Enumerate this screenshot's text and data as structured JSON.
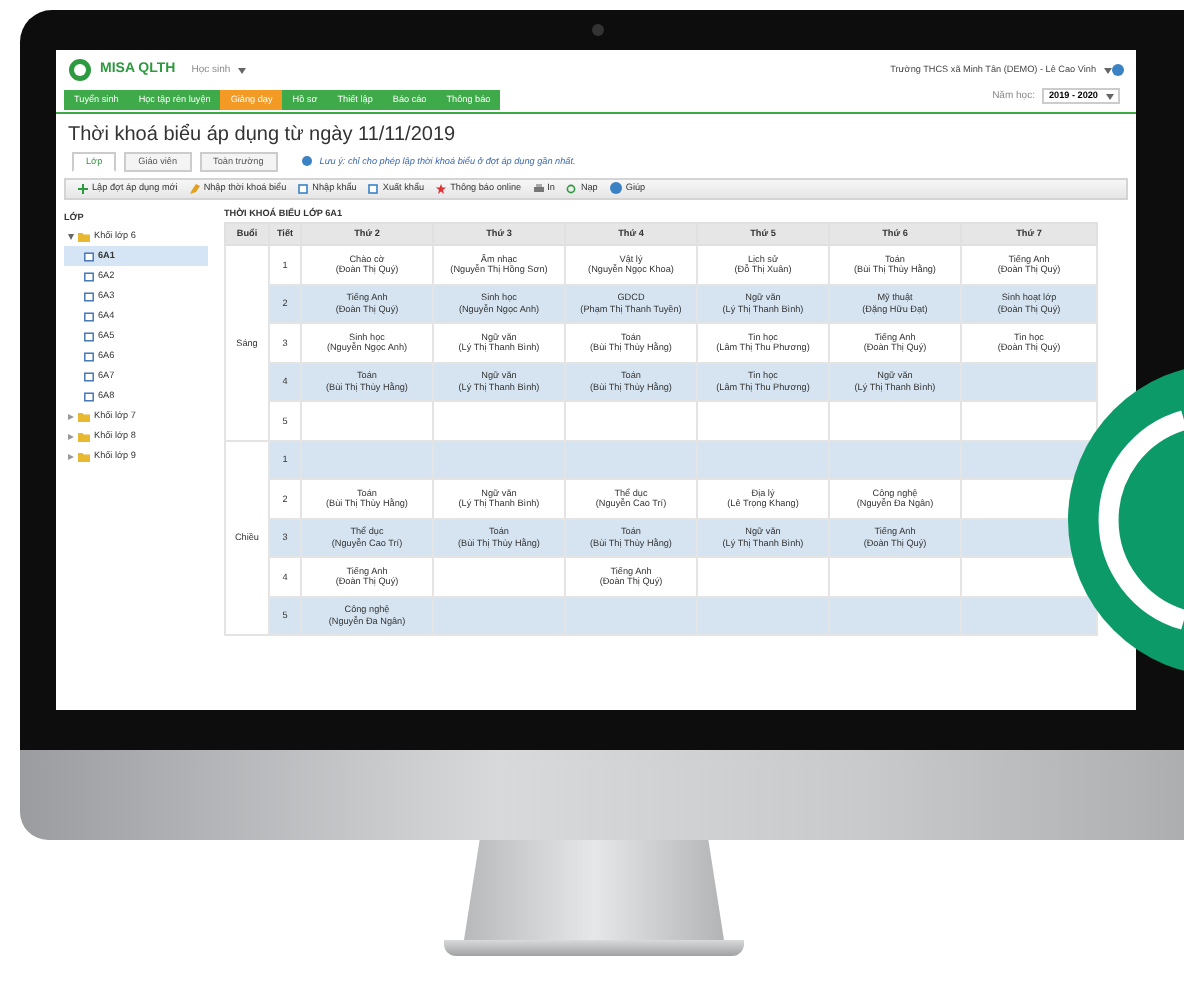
{
  "app": {
    "logo": "MISA QLTH",
    "module": "Học sinh",
    "account": "Trường THCS xã Minh Tân (DEMO) - Lê Cao Vinh",
    "school_year_label": "Năm học:",
    "school_year": "2019 - 2020"
  },
  "nav": [
    {
      "label": "Tuyển sinh",
      "selected": false
    },
    {
      "label": "Học tập rèn luyện",
      "selected": false
    },
    {
      "label": "Giảng dạy",
      "selected": true
    },
    {
      "label": "Hồ sơ",
      "selected": false
    },
    {
      "label": "Thiết lập",
      "selected": false
    },
    {
      "label": "Báo cáo",
      "selected": false
    },
    {
      "label": "Thông báo",
      "selected": false
    }
  ],
  "page_title": "Thời khoá biểu áp dụng từ ngày 11/11/2019",
  "view_tabs": [
    {
      "label": "Lớp",
      "selected": true
    },
    {
      "label": "Giáo viên",
      "selected": false
    },
    {
      "label": "Toàn trường",
      "selected": false
    }
  ],
  "note": "Lưu ý: chỉ cho phép lập thời khoá biểu ở đợt áp dụng gần nhất.",
  "toolbar": [
    "Lập đợt áp dụng mới",
    "Nhập thời khoá biểu",
    "Nhập khẩu",
    "Xuất khẩu",
    "Thông báo online",
    "In",
    "Nạp",
    "Giúp"
  ],
  "tree": {
    "heading": "LỚP",
    "items": [
      {
        "label": "Khối lớp 6",
        "expanded": true,
        "children": [
          {
            "label": "6A1",
            "selected": true
          },
          {
            "label": "6A2",
            "selected": false
          },
          {
            "label": "6A3",
            "selected": false
          },
          {
            "label": "6A4",
            "selected": false
          },
          {
            "label": "6A5",
            "selected": false
          },
          {
            "label": "6A6",
            "selected": false
          },
          {
            "label": "6A7",
            "selected": false
          },
          {
            "label": "6A8",
            "selected": false
          }
        ]
      },
      {
        "label": "Khối lớp 7",
        "expanded": false
      },
      {
        "label": "Khối lớp 8",
        "expanded": false
      },
      {
        "label": "Khối lớp 9",
        "expanded": false
      }
    ]
  },
  "timetable": {
    "title": "THỜI KHOÁ BIỂU LỚP 6A1",
    "columns": [
      "Buổi",
      "Tiết",
      "Thứ 2",
      "Thứ 3",
      "Thứ 4",
      "Thứ 5",
      "Thứ 6",
      "Thứ 7"
    ],
    "sessions": [
      {
        "name": "Sáng",
        "periods": [
          {
            "number": "1",
            "cells": [
              {
                "subject": "Chào cờ",
                "teacher": "(Đoàn Thị Quý)"
              },
              {
                "subject": "Âm nhạc",
                "teacher": "(Nguyễn Thị Hồng Sơn)"
              },
              {
                "subject": "Vật lý",
                "teacher": "(Nguyễn Ngọc Khoa)"
              },
              {
                "subject": "Lịch sử",
                "teacher": "(Đỗ Thị Xuân)"
              },
              {
                "subject": "Toán",
                "teacher": "(Bùi Thị Thùy Hằng)"
              },
              {
                "subject": "Tiếng Anh",
                "teacher": "(Đoàn Thị Quý)"
              }
            ]
          },
          {
            "number": "2",
            "cells": [
              {
                "subject": "Tiếng Anh",
                "teacher": "(Đoàn Thị Quý)"
              },
              {
                "subject": "Sinh học",
                "teacher": "(Nguyễn Ngọc Anh)"
              },
              {
                "subject": "GDCD",
                "teacher": "(Phạm Thị Thanh Tuyền)"
              },
              {
                "subject": "Ngữ văn",
                "teacher": "(Lý Thị Thanh Bình)"
              },
              {
                "subject": "Mỹ thuật",
                "teacher": "(Đặng Hữu Đạt)"
              },
              {
                "subject": "Sinh hoạt lớp",
                "teacher": "(Đoàn Thị Quý)"
              }
            ]
          },
          {
            "number": "3",
            "cells": [
              {
                "subject": "Sinh học",
                "teacher": "(Nguyễn Ngọc Anh)"
              },
              {
                "subject": "Ngữ văn",
                "teacher": "(Lý Thị Thanh Bình)"
              },
              {
                "subject": "Toán",
                "teacher": "(Bùi Thị Thùy Hằng)"
              },
              {
                "subject": "Tin học",
                "teacher": "(Lâm Thị Thu Phương)"
              },
              {
                "subject": "Tiếng Anh",
                "teacher": "(Đoàn Thị Quý)"
              },
              {
                "subject": "Tin học",
                "teacher": "(Đoàn Thị Quý)"
              }
            ]
          },
          {
            "number": "4",
            "cells": [
              {
                "subject": "Toán",
                "teacher": "(Bùi Thị Thùy Hằng)"
              },
              {
                "subject": "Ngữ văn",
                "teacher": "(Lý Thị Thanh Bình)"
              },
              {
                "subject": "Toán",
                "teacher": "(Bùi Thị Thùy Hằng)"
              },
              {
                "subject": "Tin học",
                "teacher": "(Lâm Thị Thu Phương)"
              },
              {
                "subject": "Ngữ văn",
                "teacher": "(Lý Thị Thanh Bình)"
              },
              null
            ]
          },
          {
            "number": "5",
            "cells": [
              null,
              null,
              null,
              null,
              null,
              null
            ]
          }
        ]
      },
      {
        "name": "Chiều",
        "periods": [
          {
            "number": "1",
            "cells": [
              null,
              null,
              null,
              null,
              null,
              null
            ]
          },
          {
            "number": "2",
            "cells": [
              {
                "subject": "Toán",
                "teacher": "(Bùi Thị Thùy Hằng)"
              },
              {
                "subject": "Ngữ văn",
                "teacher": "(Lý Thị Thanh Bình)"
              },
              {
                "subject": "Thể dục",
                "teacher": "(Nguyễn Cao Trí)"
              },
              {
                "subject": "Địa lý",
                "teacher": "(Lê Trọng Khang)"
              },
              {
                "subject": "Công nghệ",
                "teacher": "(Nguyễn Đa Ngân)"
              },
              null
            ]
          },
          {
            "number": "3",
            "cells": [
              {
                "subject": "Thể dục",
                "teacher": "(Nguyễn Cao Trí)"
              },
              {
                "subject": "Toán",
                "teacher": "(Bùi Thị Thùy Hằng)"
              },
              {
                "subject": "Toán",
                "teacher": "(Bùi Thị Thùy Hằng)"
              },
              {
                "subject": "Ngữ văn",
                "teacher": "(Lý Thị Thanh Bình)"
              },
              {
                "subject": "Tiếng Anh",
                "teacher": "(Đoàn Thị Quý)"
              },
              null
            ]
          },
          {
            "number": "4",
            "cells": [
              {
                "subject": "Tiếng Anh",
                "teacher": "(Đoàn Thị Quý)"
              },
              null,
              {
                "subject": "Tiếng Anh",
                "teacher": "(Đoàn Thị Quý)"
              },
              null,
              null,
              null
            ]
          },
          {
            "number": "5",
            "cells": [
              {
                "subject": "Công nghệ",
                "teacher": "(Nguyễn Đa Ngân)"
              },
              null,
              null,
              null,
              null,
              null
            ]
          }
        ]
      }
    ]
  }
}
